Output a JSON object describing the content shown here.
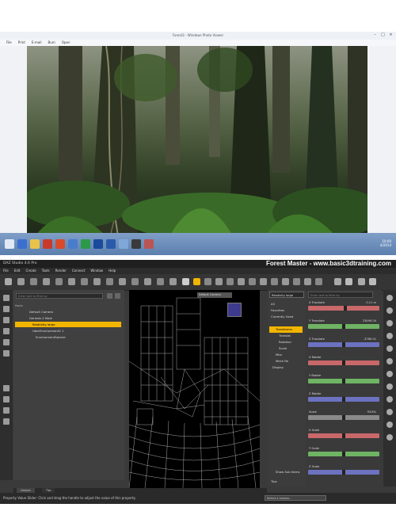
{
  "photo_viewer": {
    "window_title": "Forest3 - Windows Photo Viewer",
    "menu": [
      "File",
      "Print",
      "E-mail",
      "Burn",
      "Open"
    ],
    "clock_time": "10:00",
    "clock_date": "4/2014"
  },
  "daz": {
    "app_title": "DAZ Studio 4.6 Pro",
    "brand": "Forest Master - www.basic3dtraining.com",
    "menu": [
      "File",
      "Edit",
      "Create",
      "Tools",
      "Render",
      "Connect",
      "Window",
      "Help"
    ],
    "scene": {
      "search_placeholder": "Enter text to filter by",
      "header": "Node",
      "rows": [
        "Default Camera",
        "Genesis 2 Male",
        "Relativity large",
        "UberEnvironment2 1",
        "EnvironmentSphere"
      ]
    },
    "viewport": {
      "camera_label": "Default Camera"
    },
    "param_categories": {
      "selected_node": "Relativity large",
      "items": [
        "All",
        "Favorites",
        "Currently Used",
        "Transforms",
        "Translat",
        "Rotation",
        "Scale",
        "Misc",
        "Mesh Re",
        "Display"
      ],
      "show_sub_items": "Show Sub Items",
      "tips": "Tips"
    },
    "parameters": {
      "search_placeholder": "Enter text to filter by",
      "items": [
        {
          "label": "X Translate",
          "value": "0.11 m",
          "color": "#c8686a"
        },
        {
          "label": "Y Translate",
          "value": "23490.04",
          "color": "#6fb364"
        },
        {
          "label": "Z Translate",
          "value": "-3780.01",
          "color": "#6c72c0"
        },
        {
          "label": "X Rotate",
          "value": "",
          "color": "#c8686a"
        },
        {
          "label": "Y Rotate",
          "value": "",
          "color": "#6fb364"
        },
        {
          "label": "Z Rotate",
          "value": "",
          "color": "#6c72c0"
        },
        {
          "label": "Scale",
          "value": "93.8%",
          "color": "#8a8a8a"
        },
        {
          "label": "X Scale",
          "value": "",
          "color": "#c8686a"
        },
        {
          "label": "Y Scale",
          "value": "",
          "color": "#6fb364"
        },
        {
          "label": "Z Scale",
          "value": "",
          "color": "#6c72c0"
        }
      ]
    },
    "bottom_tabs": [
      "Lessons",
      "Tips"
    ],
    "status": "Property Value Slider: Click and drag the handle to adjust the value of this property.",
    "lesson_select": "Select a Lesson..."
  },
  "colors": {
    "daz_highlight": "#f2b500",
    "taskbar": "#6b8cba"
  }
}
